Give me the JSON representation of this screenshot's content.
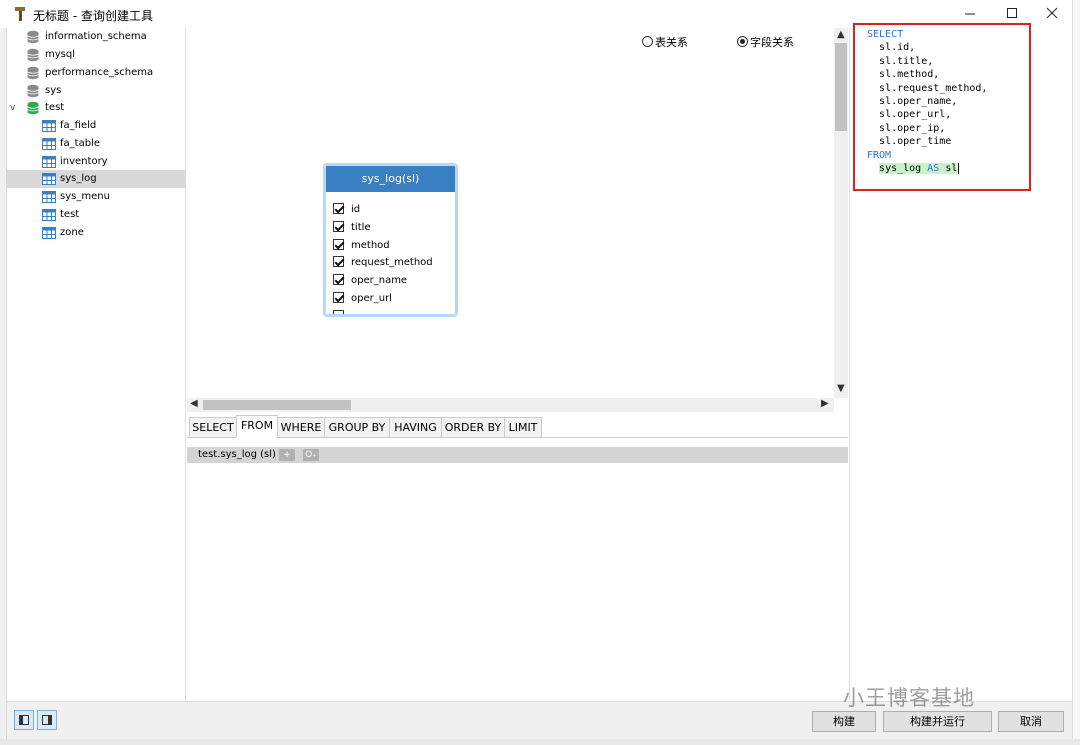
{
  "window": {
    "title": "无标题 - 查询创建工具"
  },
  "tree": {
    "items": [
      {
        "label": "information_schema",
        "kind": "db"
      },
      {
        "label": "mysql",
        "kind": "db"
      },
      {
        "label": "performance_schema",
        "kind": "db"
      },
      {
        "label": "sys",
        "kind": "db"
      },
      {
        "label": "test",
        "kind": "db-open"
      },
      {
        "label": "fa_field",
        "kind": "table"
      },
      {
        "label": "fa_table",
        "kind": "table"
      },
      {
        "label": "inventory",
        "kind": "table"
      },
      {
        "label": "sys_log",
        "kind": "table",
        "selected": true
      },
      {
        "label": "sys_menu",
        "kind": "table"
      },
      {
        "label": "test",
        "kind": "table"
      },
      {
        "label": "zone",
        "kind": "table"
      }
    ],
    "expander": "v"
  },
  "view": {
    "radio_table_relation": "表关系",
    "radio_field_relation": "字段关系",
    "selected": "字段关系"
  },
  "table_card": {
    "title": "sys_log(sl)",
    "fields": [
      {
        "name": "id",
        "checked": true
      },
      {
        "name": "title",
        "checked": true
      },
      {
        "name": "method",
        "checked": true
      },
      {
        "name": "request_method",
        "checked": true
      },
      {
        "name": "oper_name",
        "checked": true
      },
      {
        "name": "oper_url",
        "checked": true
      }
    ]
  },
  "tabs": [
    "SELECT",
    "FROM",
    "WHERE",
    "GROUP BY",
    "HAVING",
    "ORDER BY",
    "LIMIT"
  ],
  "active_tab": "FROM",
  "from_panel": {
    "entry": "test.sys_log  (sl)",
    "add_label": "+",
    "alias_label": "O₊"
  },
  "sql": {
    "select_kw": "SELECT",
    "columns": [
      "sl.id,",
      "sl.title,",
      "sl.method,",
      "sl.request_method,",
      "sl.oper_name,",
      "sl.oper_url,",
      "sl.oper_ip,",
      "sl.oper_time"
    ],
    "from_kw": "FROM",
    "table": "sys_log",
    "as_kw": "AS",
    "alias": "sl"
  },
  "footer": {
    "build": "构建",
    "build_run": "构建并运行",
    "cancel": "取消"
  },
  "watermark": "小王博客基地",
  "colors": {
    "header_blue": "#3a7fc1",
    "highlight_red": "#e02020",
    "keyword_blue": "#2f6fd8"
  }
}
